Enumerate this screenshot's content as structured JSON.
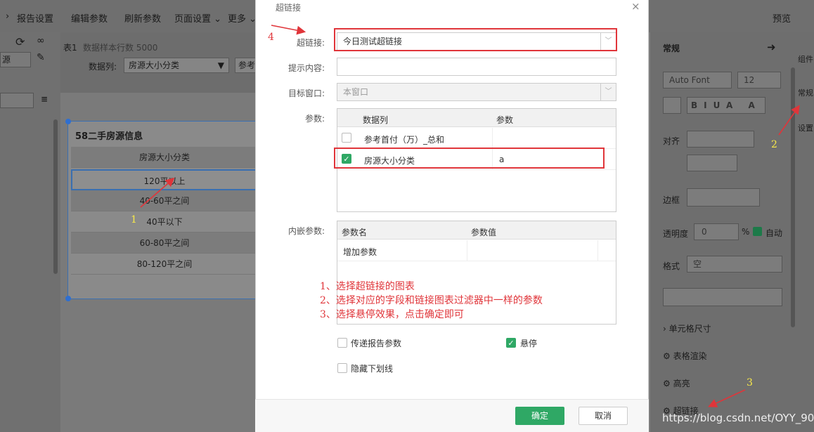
{
  "toolbar": {
    "items": [
      "报告设置",
      "编辑参数",
      "刷新参数",
      "页面设置 ⌄",
      "更多 ⌄"
    ],
    "preview": "预览"
  },
  "left": {
    "source_label": "源"
  },
  "sheet": {
    "tab": "表1",
    "sample_rows": "数据样本行数 5000",
    "datacol_label": "数据列:",
    "datacol_value": "房源大小分类",
    "ref_btn": "参考"
  },
  "widget": {
    "title": "58二手房源信息",
    "header": "房源大小分类",
    "rows": [
      "120平以上",
      "40-60平之间",
      "40平以下",
      "60-80平之间",
      "80-120平之间"
    ]
  },
  "dialog": {
    "title": "超链接",
    "hyperlink_label": "超链接:",
    "hyperlink_value": "今日测试超链接",
    "tip_label": "提示内容:",
    "target_label": "目标窗口:",
    "target_value": "本窗口",
    "params_label": "参数:",
    "params_headers": [
      "数据列",
      "参数"
    ],
    "params_rows": [
      {
        "col": "参考首付（万）_总和",
        "param": "",
        "checked": false
      },
      {
        "col": "房源大小分类",
        "param": "a",
        "checked": true
      }
    ],
    "embed_label": "内嵌参数:",
    "embed_headers": [
      "参数名",
      "参数值"
    ],
    "embed_add": "增加参数",
    "pass_params": "传递报告参数",
    "hover": "悬停",
    "hide_underline": "隐藏下划线",
    "ok": "确定",
    "cancel": "取消"
  },
  "instructions": [
    "1、选择超链接的图表",
    "2、选择对应的字段和链接图表过滤器中一样的参数",
    "3、选择悬停效果，点击确定即可"
  ],
  "right": {
    "section": "常规",
    "font": "Auto Font",
    "size": "12",
    "align": "对齐",
    "border": "边框",
    "opacity_label": "透明度",
    "opacity_value": "0",
    "auto": "自动",
    "format_label": "格式",
    "format_value": "空",
    "cell_size": "单元格尺寸",
    "table_render": "表格渲染",
    "highlight": "高亮",
    "hyperlink": "超链接",
    "side_tabs": [
      "组件",
      "常规",
      "设置"
    ]
  },
  "annotations": {
    "n1": "1",
    "n2": "2",
    "n3": "3",
    "n4": "4"
  },
  "watermark": "https://blog.csdn.net/OYY_90"
}
